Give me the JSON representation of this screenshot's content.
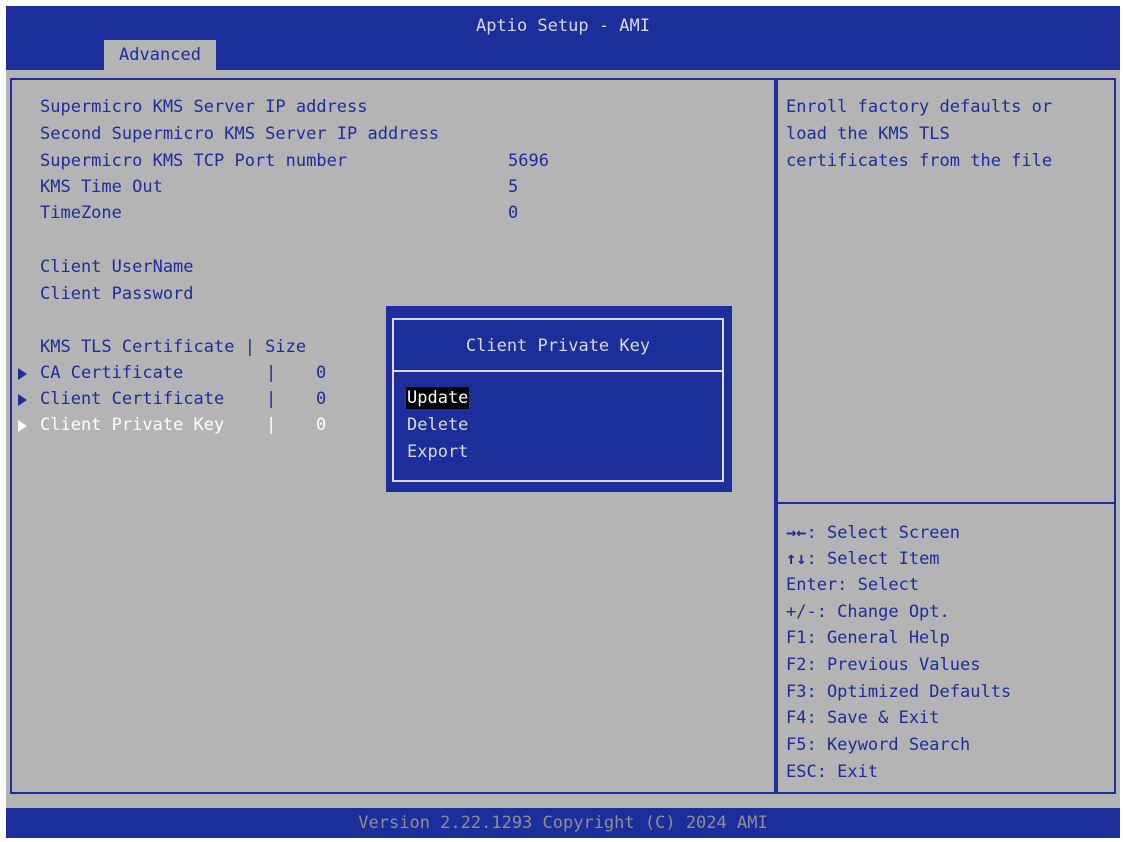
{
  "header": {
    "title": "Aptio Setup - AMI",
    "tab_label": "Advanced"
  },
  "main": {
    "settings": [
      {
        "label": "Supermicro KMS Server IP address",
        "value": ""
      },
      {
        "label": "Second Supermicro KMS Server IP address",
        "value": ""
      },
      {
        "label": "Supermicro KMS TCP Port number",
        "value": "5696"
      },
      {
        "label": "KMS Time Out",
        "value": "5"
      },
      {
        "label": "TimeZone",
        "value": "0"
      }
    ],
    "client_fields": [
      {
        "label": "Client UserName"
      },
      {
        "label": "Client Password"
      }
    ],
    "cert_header": "KMS TLS Certificate | Size",
    "certificates": [
      {
        "label": "CA Certificate",
        "sep": "|",
        "size": "0",
        "selected": false
      },
      {
        "label": "Client Certificate",
        "sep": "|",
        "size": "0",
        "selected": false
      },
      {
        "label": "Client Private Key",
        "sep": "|",
        "size": "0",
        "selected": true
      }
    ]
  },
  "dialog": {
    "title": "Client Private Key",
    "options": [
      {
        "label": "Update",
        "active": true
      },
      {
        "label": "Delete",
        "active": false
      },
      {
        "label": "Export",
        "active": false
      }
    ]
  },
  "help": {
    "description": [
      "Enroll factory defaults or",
      "load the KMS TLS",
      "certificates from the file"
    ],
    "keys": [
      {
        "key": "→←",
        "text": ": Select Screen"
      },
      {
        "key": "↑↓",
        "text": ": Select Item"
      },
      {
        "key": "",
        "text": "Enter: Select"
      },
      {
        "key": "",
        "text": "+/-: Change Opt."
      },
      {
        "key": "",
        "text": "F1: General Help"
      },
      {
        "key": "",
        "text": "F2: Previous Values"
      },
      {
        "key": "",
        "text": "F3: Optimized Defaults"
      },
      {
        "key": "",
        "text": "F4: Save & Exit"
      },
      {
        "key": "",
        "text": "F5: Keyword Search"
      },
      {
        "key": "",
        "text": "ESC: Exit"
      }
    ]
  },
  "footer": {
    "text": "Version 2.22.1293 Copyright (C) 2024 AMI"
  },
  "colors": {
    "bios_blue": "#1c2d9c",
    "panel_gray": "#b4b4b4",
    "highlight_white": "#ffffff",
    "dialog_text": "#d9d9d9"
  }
}
